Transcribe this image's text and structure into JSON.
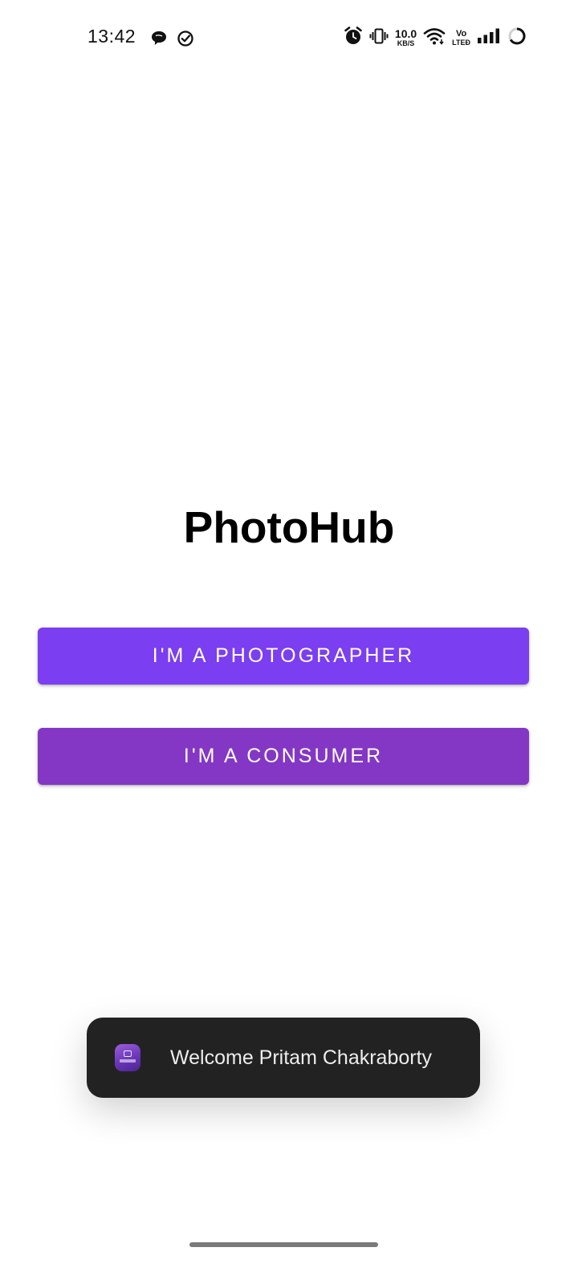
{
  "status_bar": {
    "time": "13:42",
    "net_speed_value": "10.0",
    "net_speed_unit": "KB/S",
    "volte_top": "Vo",
    "volte_bottom": "LTEĐ",
    "icons": [
      "chat-bubble-icon",
      "check-circle-icon",
      "alarm-icon",
      "vibrate-icon",
      "wifi-icon",
      "signal-icon",
      "loading-ring-icon"
    ]
  },
  "main": {
    "title": "PhotoHub",
    "photographer_button_label": "I'M A PHOTOGRAPHER",
    "consumer_button_label": "I'M A CONSUMER"
  },
  "toast": {
    "message": "Welcome Pritam Chakraborty",
    "icon": "photohub-app-icon"
  },
  "colors": {
    "photographer_button": "#7b3ef0",
    "consumer_button": "#8437c4",
    "toast_background": "#222222",
    "background": "#ffffff"
  }
}
